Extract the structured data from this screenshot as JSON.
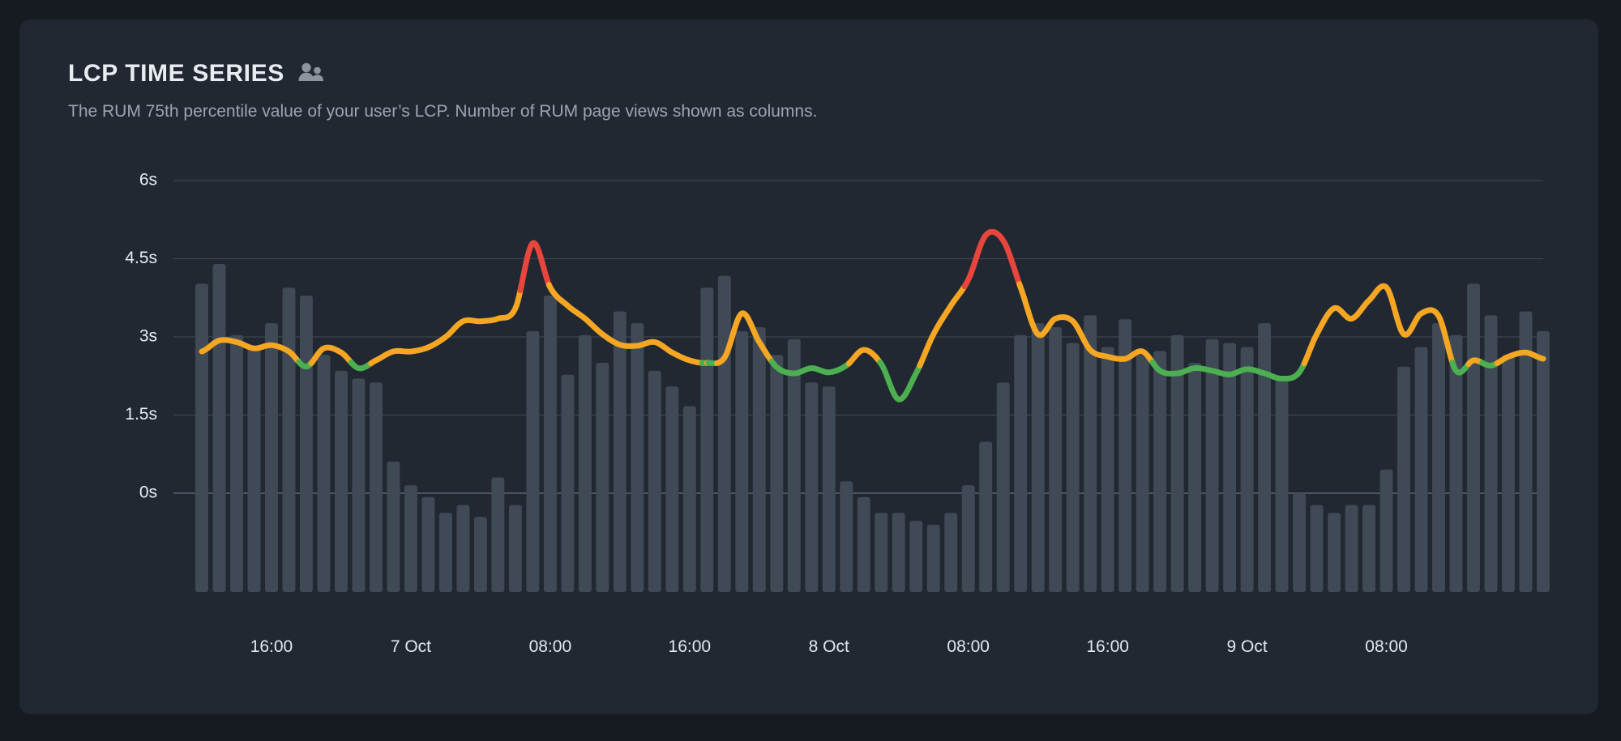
{
  "card": {
    "title": "LCP TIME SERIES",
    "title_icon": "audience-people-icon",
    "subtitle": "The RUM 75th percentile value of your user’s LCP. Number of RUM page views shown as columns."
  },
  "colors": {
    "page_background": "#161b22",
    "card_background": "#212832",
    "bar": "#3f4a56",
    "good": "#4caf50",
    "needs_improvement": "#f5a623",
    "poor": "#e8453c",
    "title": "#e9edf2",
    "subtitle": "#9aa5b1",
    "gridline": "#6a7683"
  },
  "chart_data": {
    "type": "line",
    "title": "LCP TIME SERIES",
    "subtitle": "The RUM 75th percentile value of your user’s LCP. Number of RUM page views shown as columns.",
    "xlabel": "",
    "ylabel": "",
    "ylim": [
      0,
      6
    ],
    "yunit": "s",
    "grid": true,
    "legend": false,
    "y_ticks": [
      {
        "value": 6,
        "label": "6s"
      },
      {
        "value": 4.5,
        "label": "4.5s"
      },
      {
        "value": 3,
        "label": "3s"
      },
      {
        "value": 1.5,
        "label": "1.5s"
      },
      {
        "value": 0,
        "label": "0s"
      }
    ],
    "x_ticks": [
      {
        "index": 4,
        "label": "16:00"
      },
      {
        "index": 12,
        "label": "7 Oct"
      },
      {
        "index": 20,
        "label": "08:00"
      },
      {
        "index": 28,
        "label": "16:00"
      },
      {
        "index": 36,
        "label": "8 Oct"
      },
      {
        "index": 44,
        "label": "08:00"
      },
      {
        "index": 52,
        "label": "16:00"
      },
      {
        "index": 60,
        "label": "9 Oct"
      },
      {
        "index": 68,
        "label": "08:00"
      }
    ],
    "thresholds": {
      "good_max": 2.5,
      "needs_improvement_max": 4.0,
      "good_color": "#4caf50",
      "needs_improvement_color": "#f5a623",
      "poor_color": "#e8453c"
    },
    "series": [
      {
        "name": "LCP p75 (s)",
        "type": "line",
        "unit": "s",
        "values": [
          2.72,
          2.93,
          2.9,
          2.78,
          2.84,
          2.72,
          2.43,
          2.78,
          2.7,
          2.4,
          2.55,
          2.72,
          2.72,
          2.8,
          3.0,
          3.3,
          3.3,
          3.35,
          3.55,
          4.8,
          3.95,
          3.6,
          3.35,
          3.05,
          2.85,
          2.83,
          2.9,
          2.7,
          2.55,
          2.5,
          2.6,
          3.45,
          2.9,
          2.42,
          2.3,
          2.4,
          2.32,
          2.45,
          2.75,
          2.48,
          1.8,
          2.3,
          3.05,
          3.6,
          4.1,
          4.95,
          4.85,
          3.95,
          3.05,
          3.35,
          3.3,
          2.75,
          2.62,
          2.58,
          2.72,
          2.35,
          2.3,
          2.4,
          2.35,
          2.28,
          2.38,
          2.3,
          2.2,
          2.32,
          3.05,
          3.55,
          3.35,
          3.7,
          3.95,
          3.05,
          3.45,
          3.4,
          2.35,
          2.55,
          2.45,
          2.62,
          2.7,
          2.58
        ]
      },
      {
        "name": "RUM page views",
        "type": "bar",
        "normalized_heights": [
          0.78,
          0.83,
          0.65,
          0.62,
          0.68,
          0.77,
          0.75,
          0.6,
          0.56,
          0.54,
          0.53,
          0.33,
          0.27,
          0.24,
          0.2,
          0.22,
          0.19,
          0.29,
          0.22,
          0.66,
          0.75,
          0.55,
          0.65,
          0.58,
          0.71,
          0.68,
          0.56,
          0.52,
          0.47,
          0.77,
          0.8,
          0.66,
          0.67,
          0.6,
          0.64,
          0.53,
          0.52,
          0.28,
          0.24,
          0.2,
          0.2,
          0.18,
          0.17,
          0.2,
          0.27,
          0.38,
          0.53,
          0.65,
          0.68,
          0.67,
          0.63,
          0.7,
          0.62,
          0.69,
          0.6,
          0.61,
          0.65,
          0.58,
          0.64,
          0.63,
          0.62,
          0.68,
          0.54,
          0.25,
          0.22,
          0.2,
          0.22,
          0.22,
          0.31,
          0.57,
          0.62,
          0.68,
          0.65,
          0.78,
          0.7,
          0.6,
          0.71,
          0.66
        ]
      }
    ]
  }
}
